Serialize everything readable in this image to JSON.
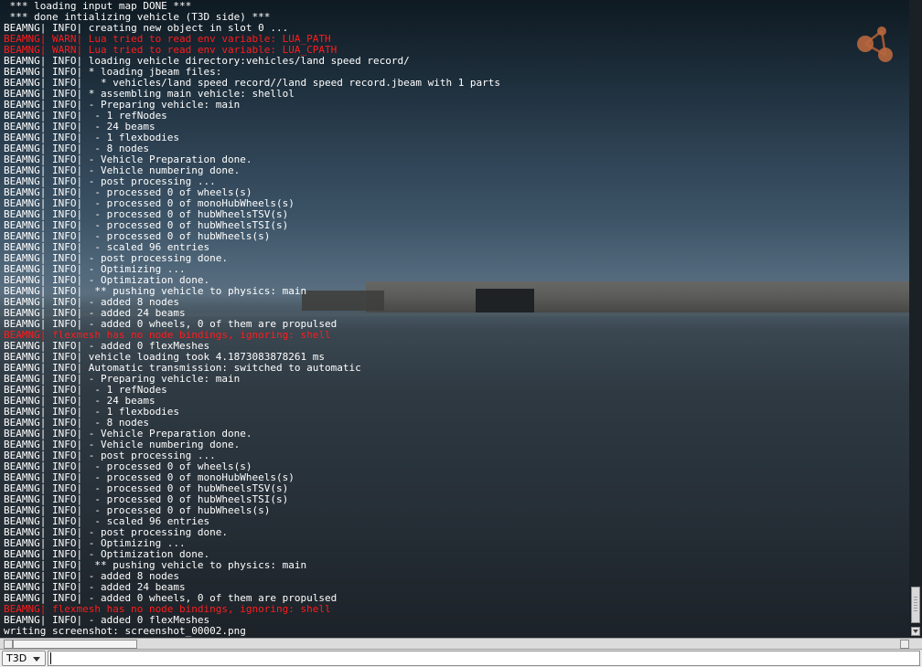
{
  "console": {
    "lines": [
      {
        "text": " *** loading input map DONE ***",
        "level": "info"
      },
      {
        "text": " *** done intializing vehicle (T3D side) ***",
        "level": "info"
      },
      {
        "text": "BEAMNG| INFO| creating new object in slot 0 ...",
        "level": "info"
      },
      {
        "text": "BEAMNG| WARN| Lua tried to read env variable: LUA_PATH",
        "level": "warn"
      },
      {
        "text": "BEAMNG| WARN| Lua tried to read env variable: LUA_CPATH",
        "level": "warn"
      },
      {
        "text": "BEAMNG| INFO| loading vehicle directory:vehicles/land speed record/",
        "level": "info"
      },
      {
        "text": "BEAMNG| INFO| * loading jbeam files:",
        "level": "info"
      },
      {
        "text": "BEAMNG| INFO|   * vehicles/land speed record//land speed record.jbeam with 1 parts",
        "level": "info"
      },
      {
        "text": "BEAMNG| INFO| * assembling main vehicle: shellol",
        "level": "info"
      },
      {
        "text": "BEAMNG| INFO| - Preparing vehicle: main",
        "level": "info"
      },
      {
        "text": "BEAMNG| INFO|  - 1 refNodes",
        "level": "info"
      },
      {
        "text": "BEAMNG| INFO|  - 24 beams",
        "level": "info"
      },
      {
        "text": "BEAMNG| INFO|  - 1 flexbodies",
        "level": "info"
      },
      {
        "text": "BEAMNG| INFO|  - 8 nodes",
        "level": "info"
      },
      {
        "text": "BEAMNG| INFO| - Vehicle Preparation done.",
        "level": "info"
      },
      {
        "text": "BEAMNG| INFO| - Vehicle numbering done.",
        "level": "info"
      },
      {
        "text": "BEAMNG| INFO| - post processing ...",
        "level": "info"
      },
      {
        "text": "BEAMNG| INFO|  - processed 0 of wheels(s)",
        "level": "info"
      },
      {
        "text": "BEAMNG| INFO|  - processed 0 of monoHubWheels(s)",
        "level": "info"
      },
      {
        "text": "BEAMNG| INFO|  - processed 0 of hubWheelsTSV(s)",
        "level": "info"
      },
      {
        "text": "BEAMNG| INFO|  - processed 0 of hubWheelsTSI(s)",
        "level": "info"
      },
      {
        "text": "BEAMNG| INFO|  - processed 0 of hubWheels(s)",
        "level": "info"
      },
      {
        "text": "BEAMNG| INFO|  - scaled 96 entries",
        "level": "info"
      },
      {
        "text": "BEAMNG| INFO| - post processing done.",
        "level": "info"
      },
      {
        "text": "BEAMNG| INFO| - Optimizing ...",
        "level": "info"
      },
      {
        "text": "BEAMNG| INFO| - Optimization done.",
        "level": "info"
      },
      {
        "text": "BEAMNG| INFO|  ** pushing vehicle to physics: main",
        "level": "info"
      },
      {
        "text": "BEAMNG| INFO| - added 8 nodes",
        "level": "info"
      },
      {
        "text": "BEAMNG| INFO| - added 24 beams",
        "level": "info"
      },
      {
        "text": "BEAMNG| INFO| - added 0 wheels, 0 of them are propulsed",
        "level": "info"
      },
      {
        "text": "BEAMNG| flexmesh has no node bindings, ignoring: shell",
        "level": "warn"
      },
      {
        "text": "BEAMNG| INFO| - added 0 flexMeshes",
        "level": "info"
      },
      {
        "text": "BEAMNG| INFO| vehicle loading took 4.1873083878261 ms",
        "level": "info"
      },
      {
        "text": "BEAMNG| INFO| Automatic transmission: switched to automatic",
        "level": "info"
      },
      {
        "text": "BEAMNG| INFO| - Preparing vehicle: main",
        "level": "info"
      },
      {
        "text": "BEAMNG| INFO|  - 1 refNodes",
        "level": "info"
      },
      {
        "text": "BEAMNG| INFO|  - 24 beams",
        "level": "info"
      },
      {
        "text": "BEAMNG| INFO|  - 1 flexbodies",
        "level": "info"
      },
      {
        "text": "BEAMNG| INFO|  - 8 nodes",
        "level": "info"
      },
      {
        "text": "BEAMNG| INFO| - Vehicle Preparation done.",
        "level": "info"
      },
      {
        "text": "BEAMNG| INFO| - Vehicle numbering done.",
        "level": "info"
      },
      {
        "text": "BEAMNG| INFO| - post processing ...",
        "level": "info"
      },
      {
        "text": "BEAMNG| INFO|  - processed 0 of wheels(s)",
        "level": "info"
      },
      {
        "text": "BEAMNG| INFO|  - processed 0 of monoHubWheels(s)",
        "level": "info"
      },
      {
        "text": "BEAMNG| INFO|  - processed 0 of hubWheelsTSV(s)",
        "level": "info"
      },
      {
        "text": "BEAMNG| INFO|  - processed 0 of hubWheelsTSI(s)",
        "level": "info"
      },
      {
        "text": "BEAMNG| INFO|  - processed 0 of hubWheels(s)",
        "level": "info"
      },
      {
        "text": "BEAMNG| INFO|  - scaled 96 entries",
        "level": "info"
      },
      {
        "text": "BEAMNG| INFO| - post processing done.",
        "level": "info"
      },
      {
        "text": "BEAMNG| INFO| - Optimizing ...",
        "level": "info"
      },
      {
        "text": "BEAMNG| INFO| - Optimization done.",
        "level": "info"
      },
      {
        "text": "BEAMNG| INFO|  ** pushing vehicle to physics: main",
        "level": "info"
      },
      {
        "text": "BEAMNG| INFO| - added 8 nodes",
        "level": "info"
      },
      {
        "text": "BEAMNG| INFO| - added 24 beams",
        "level": "info"
      },
      {
        "text": "BEAMNG| INFO| - added 0 wheels, 0 of them are propulsed",
        "level": "info"
      },
      {
        "text": "BEAMNG| flexmesh has no node bindings, ignoring: shell",
        "level": "warn"
      },
      {
        "text": "BEAMNG| INFO| - added 0 flexMeshes",
        "level": "info"
      },
      {
        "text": "writing screenshot: screenshot_00002.png",
        "level": "info"
      }
    ],
    "colors": {
      "info": "#ffffff",
      "warn": "#ff1c1c"
    }
  },
  "logo": {
    "icon": "molecule-logo-icon",
    "color": "#c0693a"
  },
  "command_bar": {
    "interpreter_selected": "T3D",
    "input_value": ""
  }
}
